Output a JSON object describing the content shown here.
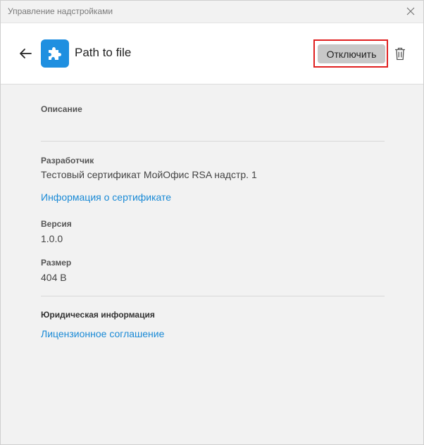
{
  "window": {
    "title": "Управление надстройками"
  },
  "header": {
    "addon_name": "Path to file",
    "disable_label": "Отключить"
  },
  "details": {
    "description_label": "Описание",
    "description_value": "",
    "developer_label": "Разработчик",
    "developer_value": "Тестовый сертификат МойОфис RSA надстр. 1",
    "certificate_link": "Информация о сертификате",
    "version_label": "Версия",
    "version_value": "1.0.0",
    "size_label": "Размер",
    "size_value": "404 B",
    "legal_label": "Юридическая информация",
    "license_link": "Лицензионное соглашение"
  },
  "colors": {
    "accent": "#1f8fe0",
    "link": "#1a8ad6",
    "highlight": "#e02020",
    "button_bg": "#c8c8c8"
  },
  "icons": [
    "close-icon",
    "back-arrow-icon",
    "puzzle-icon",
    "trash-icon"
  ]
}
